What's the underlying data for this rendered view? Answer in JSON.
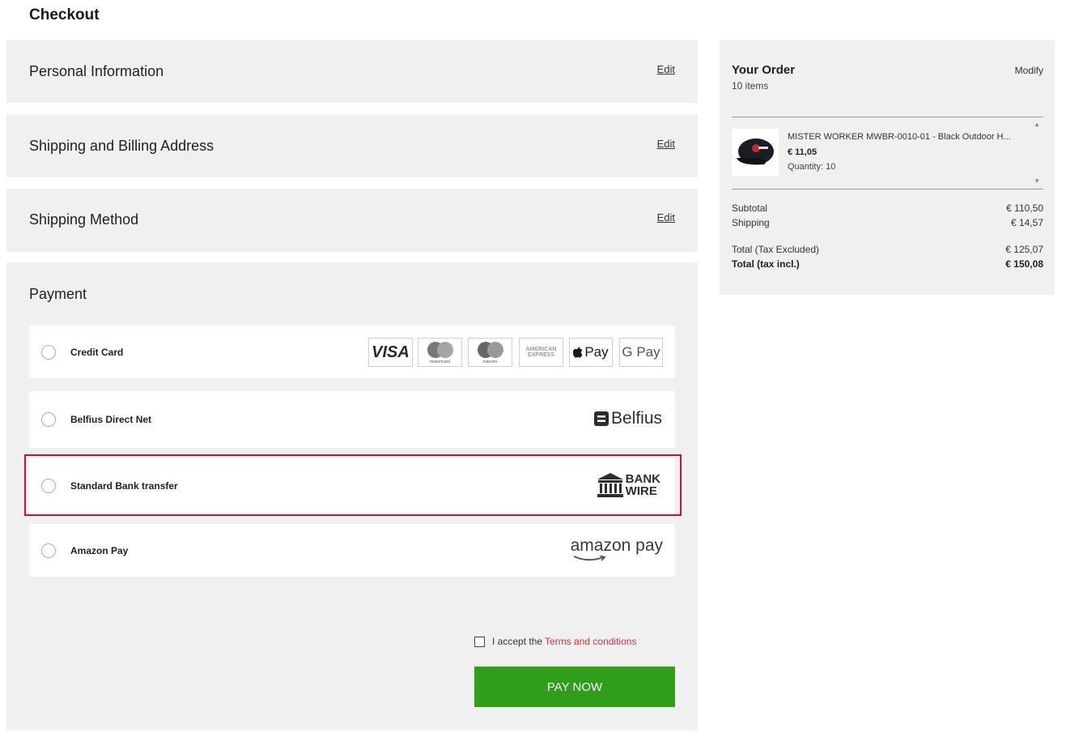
{
  "page": {
    "title": "Checkout"
  },
  "sections": {
    "personal": {
      "title": "Personal Information",
      "edit": "Edit"
    },
    "shipping_address": {
      "title": "Shipping and Billing Address",
      "edit": "Edit"
    },
    "shipping_method": {
      "title": "Shipping Method",
      "edit": "Edit"
    },
    "payment": {
      "title": "Payment"
    }
  },
  "payment_options": [
    {
      "label": "Credit Card",
      "logos": [
        "VISA",
        "mastercard",
        "maestro",
        "AMERICAN EXPRESS",
        "Pay",
        "G Pay"
      ]
    },
    {
      "label": "Belfius Direct Net",
      "logo": "Belfius"
    },
    {
      "label": "Standard Bank transfer",
      "logo_line1": "BANK",
      "logo_line2": "WIRE"
    },
    {
      "label": "Amazon Pay",
      "logo": "amazon pay"
    }
  ],
  "terms": {
    "prefix": "I accept the",
    "link": "Terms and conditions"
  },
  "pay_button": {
    "label": "PAY NOW"
  },
  "order": {
    "title": "Your Order",
    "count": "10 items",
    "modify": "Modify",
    "item": {
      "name": "MISTER WORKER MWBR-0010-01 - Black Outdoor H...",
      "price": "€ 11,05",
      "quantity": "Quantity: 10"
    },
    "subtotal_label": "Subtotal",
    "subtotal": "€ 110,50",
    "shipping_label": "Shipping",
    "shipping": "€ 14,57",
    "total_excl_label": "Total (Tax Excluded)",
    "total_excl": "€ 125,07",
    "total_incl_label": "Total (tax incl.)",
    "total_incl": "€ 150,08"
  },
  "colors": {
    "accent_green": "#2f9e1b",
    "highlight_red": "#d0102a",
    "link_red": "#c8333a",
    "panel_bg": "#f0f0f0"
  }
}
